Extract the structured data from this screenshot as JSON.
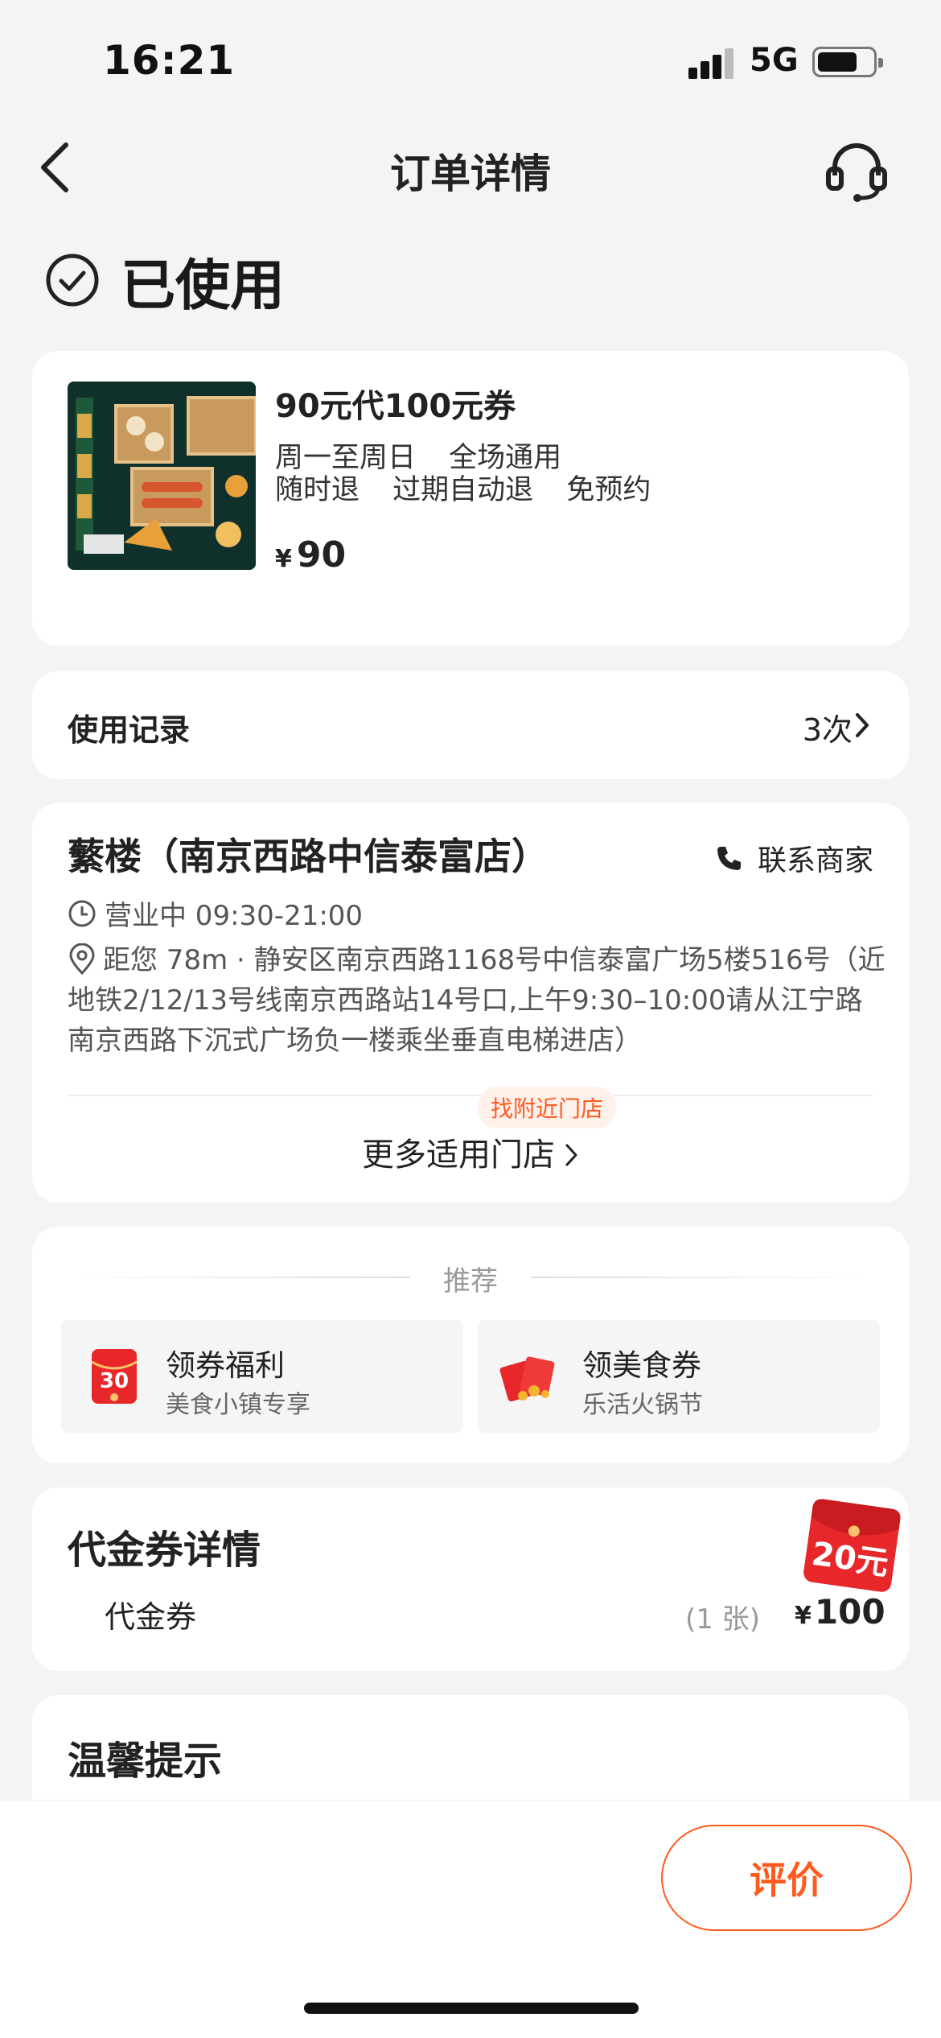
{
  "status_bar": {
    "time": "16:21",
    "network": "5G",
    "battery_percent": 70
  },
  "nav": {
    "title": "订单详情",
    "back_icon": "chevron-left-icon",
    "service_icon": "headset-icon"
  },
  "order_status": {
    "text": "已使用",
    "icon": "check-circle-icon"
  },
  "product": {
    "title": "90元代100元券",
    "tags_line1": [
      "周一至周日",
      "全场通用"
    ],
    "tags_line2": [
      "随时退",
      "过期自动退",
      "免预约"
    ],
    "currency": "¥",
    "price": "90"
  },
  "usage_record": {
    "label": "使用记录",
    "count": "3次"
  },
  "store": {
    "name": "蘩楼（南京西路中信泰富店）",
    "contact_label": "联系商家",
    "hours": "营业中 09:30-21:00",
    "address": "距您 78m · 静安区南京西路1168号中信泰富广场5楼516号（近地铁2/12/13号线南京西路站14号口,上午9:30–10:00请从江宁路南京西路下沉式广场负一楼乘坐垂直电梯进店）",
    "nearby_tag": "找附近门店",
    "more_stores": "更多适用门店"
  },
  "recommend": {
    "header": "推荐",
    "items": [
      {
        "title": "领券福利",
        "subtitle": "美食小镇专享",
        "badge": "30",
        "icon": "coupon-30-icon"
      },
      {
        "title": "领美食券",
        "subtitle": "乐活火锅节",
        "icon": "red-envelope-icon"
      }
    ]
  },
  "voucher_detail": {
    "title": "代金券详情",
    "item_name": "代金券",
    "quantity": "(1 张)",
    "currency": "¥",
    "price": "100",
    "packet_badge": "20元"
  },
  "tips": {
    "title": "温馨提示"
  },
  "actions": {
    "review_label": "评价"
  },
  "colors": {
    "accent": "#ff5a1f",
    "page_bg": "#f4f4f4",
    "card_bg": "#ffffff",
    "red": "#e8272a"
  }
}
